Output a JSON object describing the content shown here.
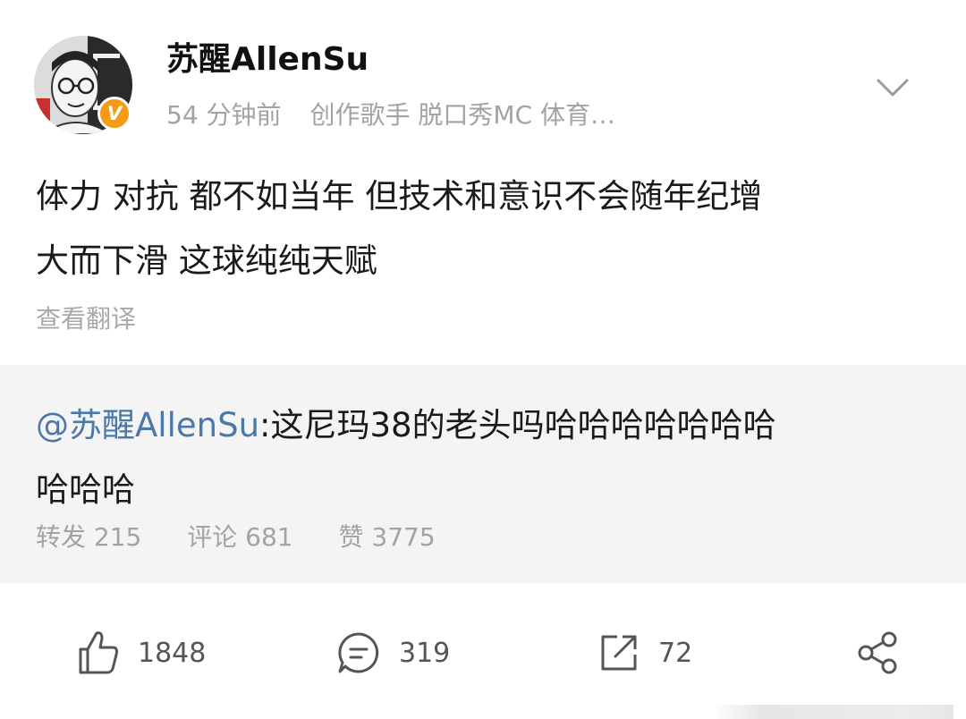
{
  "post": {
    "username": "苏醒AllenSu",
    "badge": "V",
    "time": "54 分钟前",
    "bio": "创作歌手 脱口秀MC 体育…",
    "content_line1": "体力 对抗 都不如当年 但技术和意识不会随年纪增",
    "content_line2": "大而下滑 这球纯纯天赋",
    "translate_label": "查看翻译"
  },
  "retweet": {
    "mention": "@苏醒AllenSu",
    "text_line1": ":这尼玛38的老头吗哈哈哈哈哈哈哈",
    "text_line2": "哈哈哈",
    "repost_label": "转发 215",
    "comment_label": "评论 681",
    "like_label": "赞 3775"
  },
  "actions": {
    "like_count": "1848",
    "comment_count": "319",
    "repost_count": "72"
  },
  "colors": {
    "mention": "#4b78a8",
    "badge": "#f39b17",
    "muted": "#a3a3a3",
    "retweet_bg": "#f4f4f4"
  },
  "icons": [
    "chevron-down-icon",
    "thumbs-up-icon",
    "comment-icon",
    "repost-icon",
    "share-icon"
  ]
}
